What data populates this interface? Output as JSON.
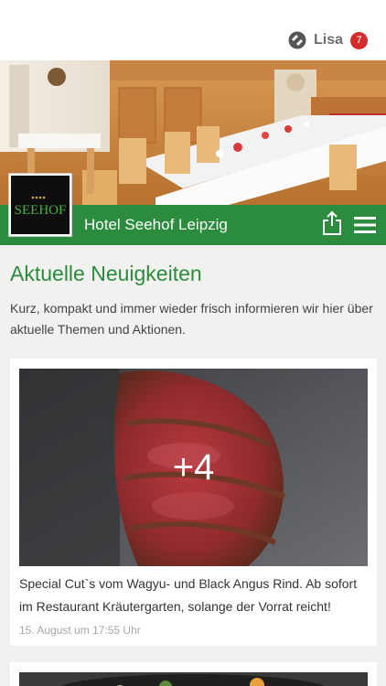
{
  "header": {
    "user_name": "Lisa",
    "notification_count": "7"
  },
  "hotel": {
    "name": "Hotel Seehof Leipzig",
    "logo_text": "SEEHOF"
  },
  "news": {
    "title": "Aktuelle Neuigkeiten",
    "intro": "Kurz, kompakt und immer wieder frisch informieren wir hier über aktuelle Themen und Aktionen.",
    "items": [
      {
        "more_images": "+4",
        "text": "Special Cut`s vom Wagyu- und Black Angus Rind. Ab sofort im Restaurant Kräutergarten, solange der Vorrat reicht!",
        "date": "15. August um 17:55 Uhr"
      }
    ]
  },
  "colors": {
    "brand_green": "#2a8c3c",
    "badge_red": "#d42b2b"
  }
}
